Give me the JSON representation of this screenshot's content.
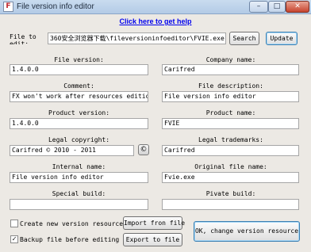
{
  "window": {
    "title": "File version info editor",
    "minimize_glyph": "–",
    "maximize_glyph": "□",
    "close_glyph": "✕",
    "app_icon_glyph": "F"
  },
  "help_link": "Click here to get help",
  "file_row": {
    "label": "File to edit:",
    "path": "360安全浏览器下载\\fileversioninfoeditor\\FVIE.exe",
    "search_label": "Search",
    "update_label": "Update"
  },
  "fields": {
    "file_version": {
      "label": "File version:",
      "value": "1.4.0.0"
    },
    "company_name": {
      "label": "Company name:",
      "value": "Carifred"
    },
    "comment": {
      "label": "Comment:",
      "value": "FX won't work after resources edition."
    },
    "file_description": {
      "label": "File description:",
      "value": "File version info editor"
    },
    "product_version": {
      "label": "Product version:",
      "value": "1.4.0.0"
    },
    "product_name": {
      "label": "Product name:",
      "value": "FVIE"
    },
    "legal_copyright": {
      "label": "Legal copyright:",
      "value": "Carifred © 2010 - 2011"
    },
    "legal_trademarks": {
      "label": "Legal trademarks:",
      "value": "Carifred"
    },
    "internal_name": {
      "label": "Internal name:",
      "value": "File version info editor"
    },
    "original_file_name": {
      "label": "Original file name:",
      "value": "Fvie.exe"
    },
    "special_build": {
      "label": "Special build:",
      "value": ""
    },
    "private_build": {
      "label": "Pivate build:",
      "value": ""
    }
  },
  "copyright_symbol_button": "©",
  "options": {
    "create_new_resource": {
      "label": "Create new version resource",
      "checked": false,
      "mark": ""
    },
    "backup_file": {
      "label": "Backup file before editing",
      "checked": true,
      "mark": "✓"
    }
  },
  "buttons": {
    "import": "Import fron file",
    "export": "Export to file",
    "ok": "OK, change version resource"
  }
}
